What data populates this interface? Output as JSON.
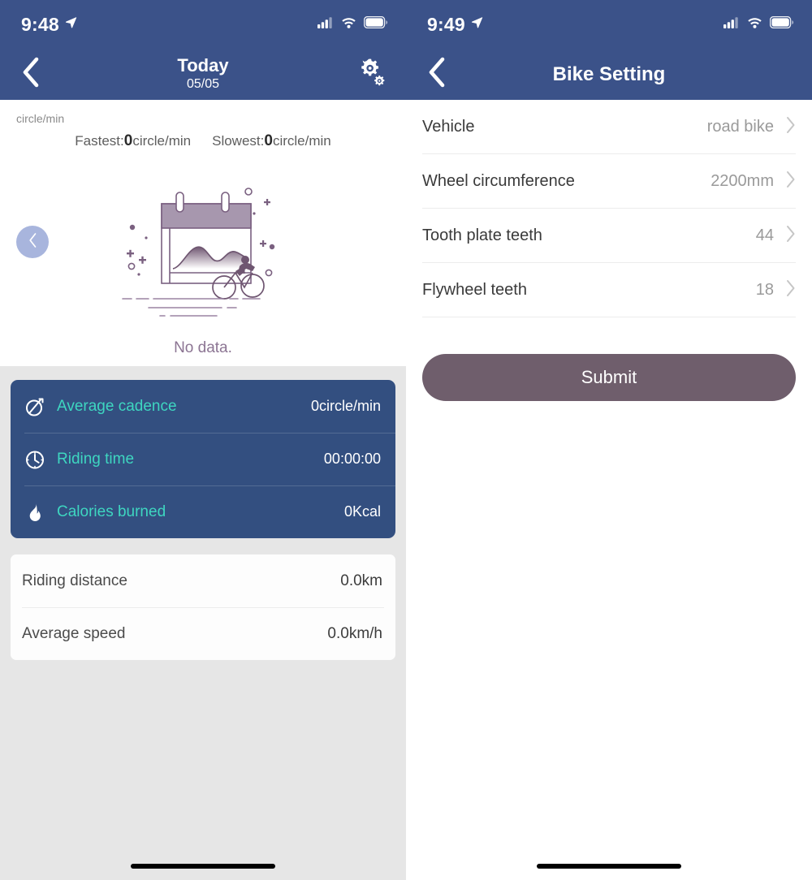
{
  "colors": {
    "header_blue": "#3b5289",
    "card_blue": "#334f80",
    "teal": "#3ed6c0",
    "submit_purple": "#6f5e6c",
    "illustration_purple": "#8c7593",
    "circle_back_bg": "#a8b5dd",
    "gray_bg": "#e6e6e6"
  },
  "left_screen": {
    "status_bar": {
      "time": "9:48",
      "location_icon": "location-arrow-icon",
      "signal_icon": "cellular-signal-icon",
      "wifi_icon": "wifi-icon",
      "battery_icon": "battery-full-icon"
    },
    "nav": {
      "back_icon": "chevron-left-icon",
      "title": "Today",
      "subtitle": "05/05",
      "settings_icon": "gear-icon"
    },
    "chart": {
      "unit_label": "circle/min",
      "fastest_label": "Fastest:",
      "fastest_value": "0",
      "fastest_unit": "circle/min",
      "slowest_label": "Slowest:",
      "slowest_value": "0",
      "slowest_unit": "circle/min",
      "empty_text": "No data.",
      "prev_icon": "chevron-left-icon"
    },
    "stats_card": [
      {
        "icon": "cadence-icon",
        "label": "Average cadence",
        "value": "0circle/min"
      },
      {
        "icon": "clock-icon",
        "label": "Riding time",
        "value": "00:00:00"
      },
      {
        "icon": "flame-icon",
        "label": "Calories burned",
        "value": "0Kcal"
      }
    ],
    "secondary_card": [
      {
        "label": "Riding distance",
        "value": "0.0km"
      },
      {
        "label": "Average speed",
        "value": "0.0km/h"
      }
    ]
  },
  "right_screen": {
    "status_bar": {
      "time": "9:49",
      "location_icon": "location-arrow-icon",
      "signal_icon": "cellular-signal-icon",
      "wifi_icon": "wifi-icon",
      "battery_icon": "battery-full-icon"
    },
    "nav": {
      "back_icon": "chevron-left-icon",
      "title": "Bike Setting"
    },
    "settings": [
      {
        "label": "Vehicle",
        "value": "road bike",
        "chevron": "chevron-right-icon"
      },
      {
        "label": "Wheel circumference",
        "value": "2200mm",
        "chevron": "chevron-right-icon"
      },
      {
        "label": "Tooth plate teeth",
        "value": "44",
        "chevron": "chevron-right-icon"
      },
      {
        "label": "Flywheel teeth",
        "value": "18",
        "chevron": "chevron-right-icon"
      }
    ],
    "submit_label": "Submit"
  }
}
